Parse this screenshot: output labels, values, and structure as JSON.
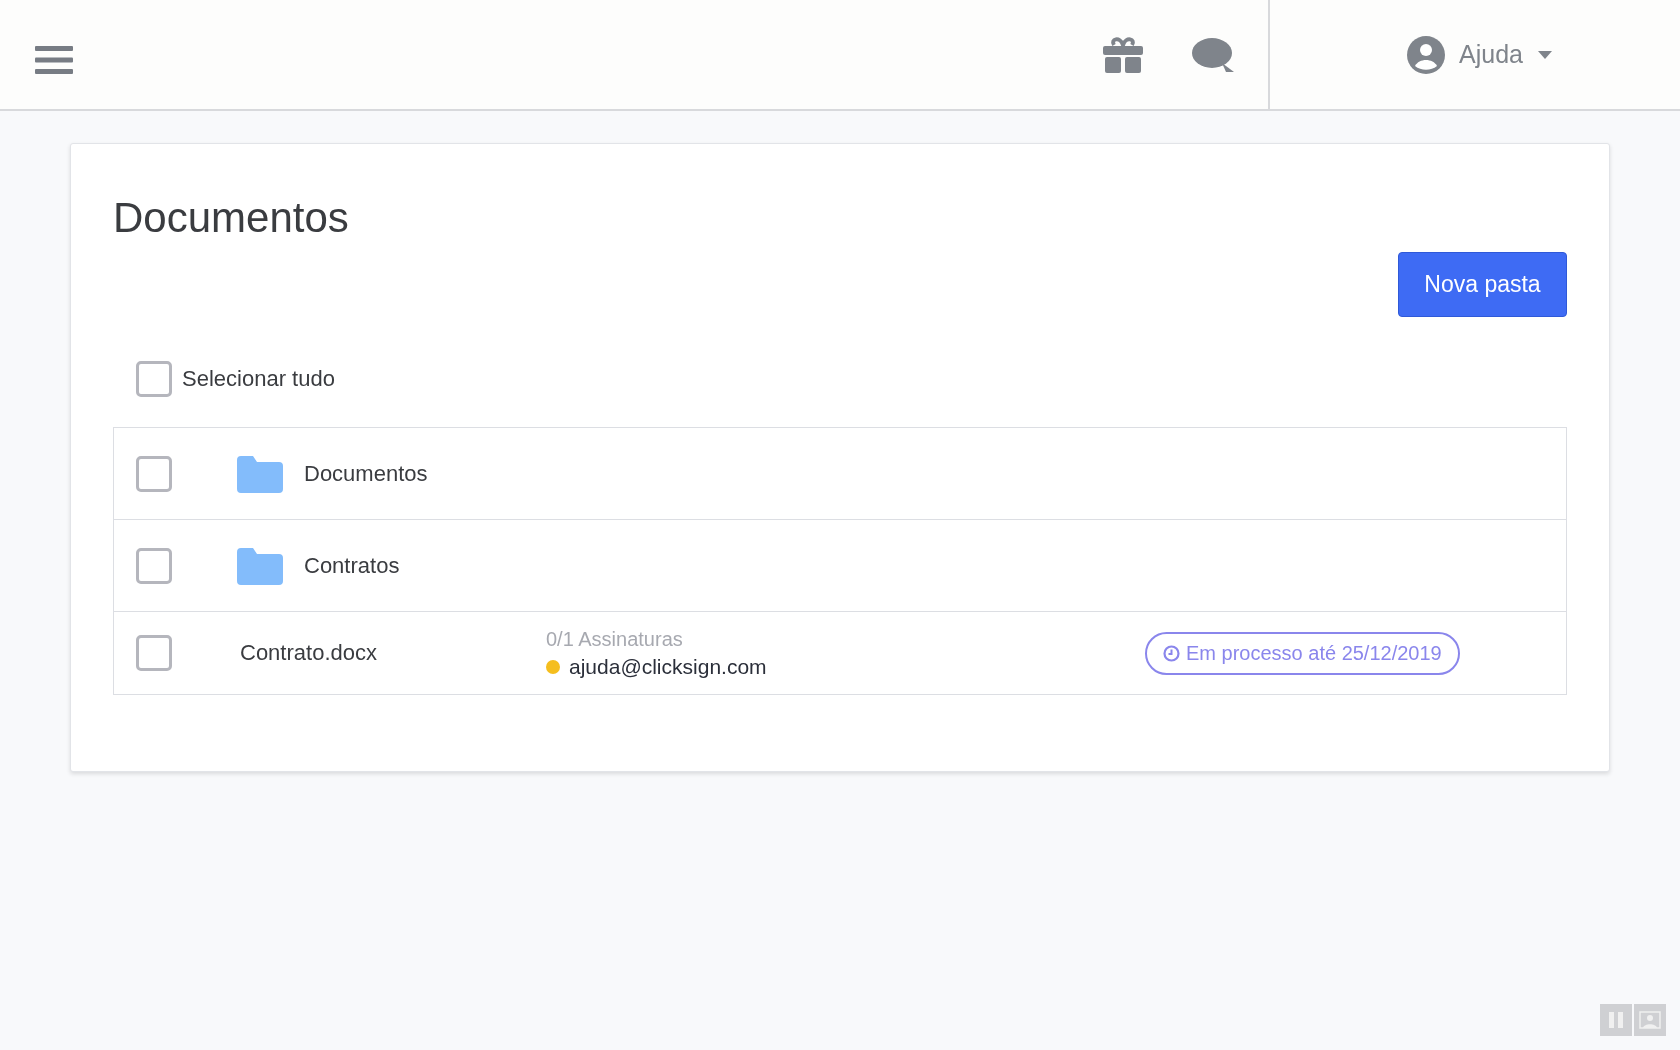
{
  "header": {
    "user_menu": {
      "label": "Ajuda"
    }
  },
  "page": {
    "title": "Documentos",
    "new_folder_button": "Nova pasta",
    "select_all": {
      "label": "Selecionar tudo",
      "checked": false
    }
  },
  "rows": [
    {
      "kind": "folder",
      "name": "Documentos",
      "checked": false
    },
    {
      "kind": "folder",
      "name": "Contratos",
      "checked": false
    },
    {
      "kind": "file",
      "name": "Contrato.docx",
      "checked": false,
      "signatures": "0/1 Assinaturas",
      "signer": {
        "email": "ajuda@clicksign.com",
        "color": "#f5be1e"
      },
      "status": "Em processo até 25/12/2019"
    }
  ]
}
